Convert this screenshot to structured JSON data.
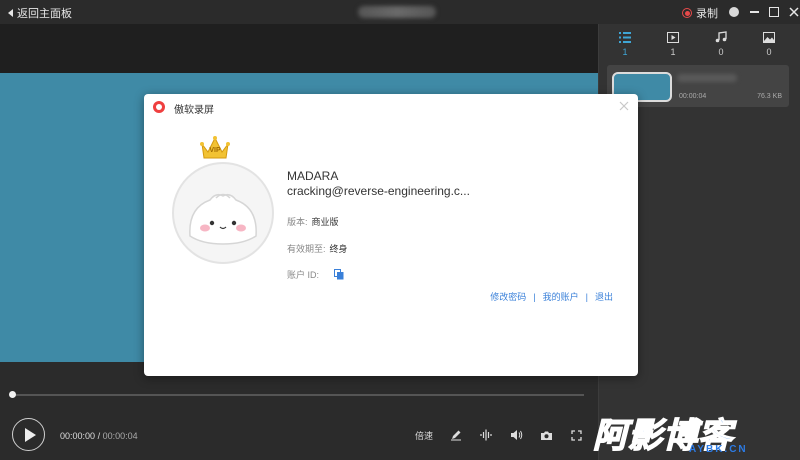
{
  "titlebar": {
    "back_label": "返回主面板",
    "record_label": "录制",
    "colors": {
      "record": "#e84a4a"
    }
  },
  "sidebar": {
    "tabs": [
      {
        "icon": "list-icon",
        "count": "1",
        "active": true
      },
      {
        "icon": "video-icon",
        "count": "1"
      },
      {
        "icon": "music-icon",
        "count": "0"
      },
      {
        "icon": "image-icon",
        "count": "0"
      }
    ],
    "recording_item": {
      "duration": "00:00:04",
      "size": "76.3 KB"
    }
  },
  "player": {
    "current_time": "00:00:00",
    "separator": "/",
    "total_time": "00:00:04",
    "speed_label": "倍速",
    "progress": 0,
    "colors": {
      "video": "#3f8aa6"
    }
  },
  "dialog": {
    "title": "傲软录屏",
    "vip_badge": "VIP",
    "username": "MADARA",
    "email": "cracking@reverse-engineering.c...",
    "version_label": "版本:",
    "version_value": "商业版",
    "expiry_label": "有效期至:",
    "expiry_value": "终身",
    "account_id_label": "账户 ID:",
    "links": {
      "change_password": "修改密码",
      "my_account": "我的账户",
      "logout": "退出",
      "separator": "|"
    },
    "colors": {
      "link": "#3a80d9",
      "logo": "#ef3f3f"
    }
  },
  "watermark": {
    "text": "阿影博客",
    "sub": "AYBK.CN",
    "color": "#2c7be5"
  }
}
